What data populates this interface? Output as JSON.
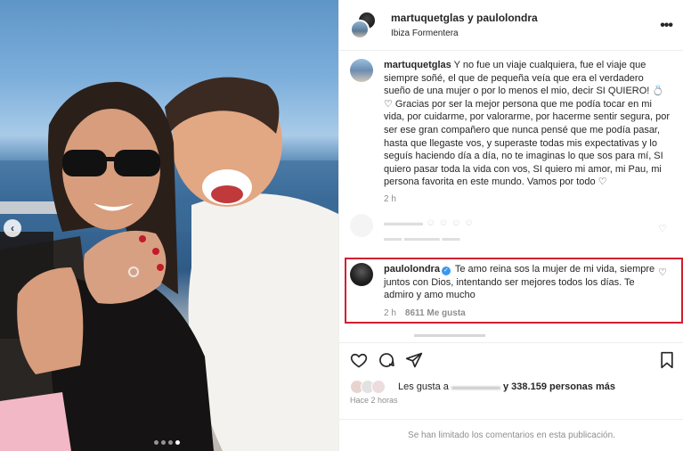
{
  "photo": {
    "carousel_prev_glyph": "‹",
    "slides_count": 4,
    "active_slide": 4
  },
  "header": {
    "title": "martuquetglas y paulolondra",
    "location": "Ibiza Formentera",
    "more_glyph": "•••"
  },
  "caption": {
    "username": "martuquetglas",
    "text": "Y no fue un viaje cualquiera, fue el viaje que siempre soñé, el que de pequeña veía que era el verdadero sueño de una mujer o por lo menos el mio, decir SI QUIERO! 💍 ♡ Gracias por ser la mejor persona que me podía tocar en mi vida, por cuidarme, por valorarme, por hacerme sentir segura, por ser ese gran compañero que nunca pensé que me podía pasar, hasta que llegaste vos, y superaste todas mis expectativas y lo seguís haciendo día a día, no te imaginas lo que sos para mí, SI quiero pasar toda la vida con vos, SI quiero mi amor, mi Pau, mi persona favorita en este mundo. Vamos por todo ♡",
    "time": "2 h"
  },
  "comment": {
    "username": "paulolondra",
    "verified_glyph": "✓",
    "text": "Te amo reina sos la mujer de mi vida, siempre juntos con Dios, intentando ser mejores todos los días. Te admiro y amo mucho",
    "time": "2 h",
    "likes": "8611 Me gusta"
  },
  "likes": {
    "prefix": "Les gusta a",
    "count": "y 338.159 personas más"
  },
  "post_time": "Hace 2 horas",
  "footer": {
    "limited_comments": "Se han limitado los comentarios en esta publicación."
  },
  "colors": {
    "highlight_border": "#d1202f",
    "verified": "#3897f0",
    "secondary_text": "#8e8e8e"
  }
}
